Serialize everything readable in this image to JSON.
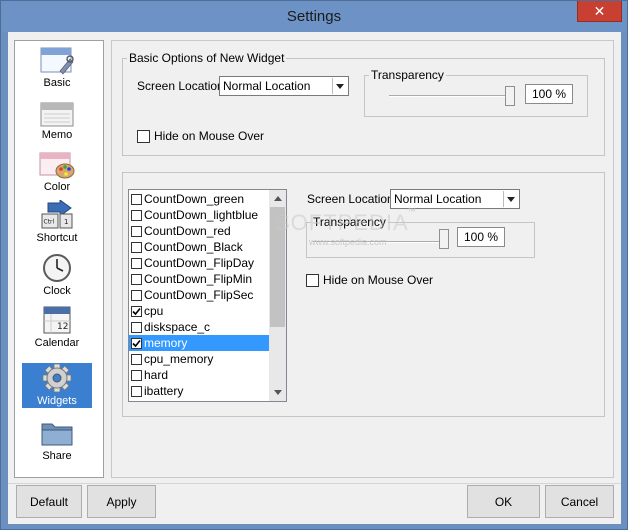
{
  "window": {
    "title": "Settings",
    "close_glyph": "✕"
  },
  "sidebar": {
    "items": [
      {
        "label": "Basic",
        "icon": "basic-window-icon"
      },
      {
        "label": "Memo",
        "icon": "memo-window-icon"
      },
      {
        "label": "Color",
        "icon": "color-palette-icon"
      },
      {
        "label": "Shortcut",
        "icon": "shortcut-key-icon"
      },
      {
        "label": "Clock",
        "icon": "clock-icon"
      },
      {
        "label": "Calendar",
        "icon": "calendar-icon"
      },
      {
        "label": "Widgets",
        "icon": "gear-icon",
        "selected": true
      },
      {
        "label": "Share",
        "icon": "folder-icon"
      }
    ]
  },
  "basic_options": {
    "legend": "Basic Options of New Widget",
    "screen_location_label": "Screen Location",
    "screen_location_value": "Normal Location",
    "transparency_legend": "Transparency",
    "transparency_value": "100 %",
    "transparency_level": 1.0,
    "hide_on_mouse_label": "Hide on Mouse Over",
    "hide_on_mouse_checked": false
  },
  "widgets": {
    "items": [
      {
        "name": "CountDown_green",
        "checked": false
      },
      {
        "name": "CountDown_lightblue",
        "checked": false
      },
      {
        "name": "CountDown_red",
        "checked": false
      },
      {
        "name": "CountDown_Black",
        "checked": false
      },
      {
        "name": "CountDown_FlipDay",
        "checked": false
      },
      {
        "name": "CountDown_FlipMin",
        "checked": false
      },
      {
        "name": "CountDown_FlipSec",
        "checked": false
      },
      {
        "name": "cpu",
        "checked": true
      },
      {
        "name": "diskspace_c",
        "checked": false
      },
      {
        "name": "memory",
        "checked": true,
        "selected": true
      },
      {
        "name": "cpu_memory",
        "checked": false
      },
      {
        "name": "hard",
        "checked": false
      },
      {
        "name": "ibattery",
        "checked": false
      }
    ],
    "screen_location_label": "Screen Location",
    "screen_location_value": "Normal Location",
    "transparency_legend": "Transparency",
    "transparency_value": "100 %",
    "transparency_level": 1.0,
    "hide_on_mouse_label": "Hide on Mouse Over",
    "hide_on_mouse_checked": false
  },
  "watermark": {
    "main": "SOFTPEDIA",
    "tm": "™",
    "sub": "www.softpedia.com"
  },
  "footer": {
    "default_label": "Default",
    "apply_label": "Apply",
    "ok_label": "OK",
    "cancel_label": "Cancel"
  },
  "colors": {
    "title_bar": "#6d93c6",
    "selection": "#3399ff",
    "sidebar_selection": "#3a7fd0",
    "close": "#c84031"
  }
}
